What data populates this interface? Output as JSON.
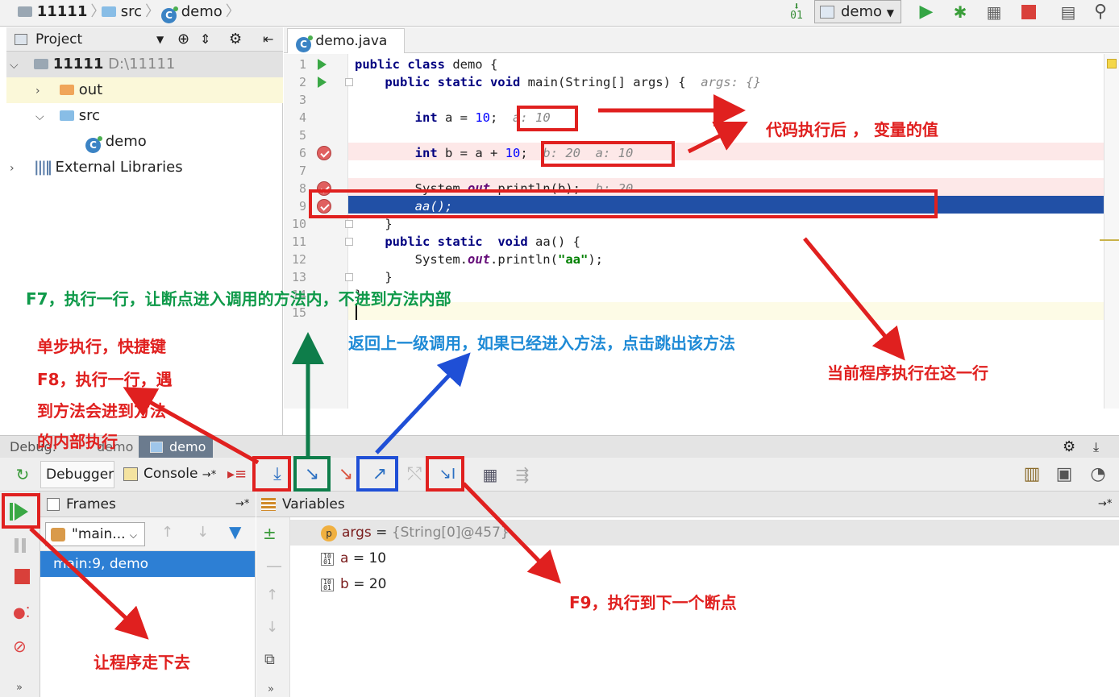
{
  "breadcrumb": {
    "project": "11111",
    "folder": "src",
    "file": "demo"
  },
  "toolbar": {
    "run_config": "demo"
  },
  "project_panel": {
    "title": "Project",
    "tree": [
      {
        "label": "11111",
        "path": "D:\\11111"
      },
      {
        "label": "out"
      },
      {
        "label": "src"
      },
      {
        "label": "demo"
      },
      {
        "label": "External Libraries"
      }
    ]
  },
  "editor": {
    "tab_label": "demo.java",
    "lines": {
      "l1": {
        "kw": "public class",
        "rest": " demo {"
      },
      "l2": {
        "kw": "public static void",
        "rest": " main(String[] args) {  ",
        "hint": "args: {}"
      },
      "l4": {
        "kw": "int",
        "rest": " a = ",
        "num": "10",
        "end": ";  ",
        "hint": "a: 10"
      },
      "l6": {
        "kw": "int",
        "rest": " b = a + ",
        "num": "10",
        "end": ";  ",
        "hint": "b: 20  a: 10"
      },
      "l8": {
        "pre": "System.",
        "fld": "out",
        "post": ".println(b);  ",
        "hint": "b: 20"
      },
      "l9": {
        "code": "aa();"
      },
      "l10": {
        "code": "}"
      },
      "l11": {
        "kw": "public static",
        "mid": "  ",
        "kw2": "void",
        "rest": " aa() {"
      },
      "l12": {
        "pre": "System.",
        "fld": "out",
        "post": ".println(",
        "str": "\"aa\"",
        "end": ");"
      },
      "l13": {
        "code": "}"
      },
      "l14": {
        "code": "}"
      }
    },
    "line_numbers": [
      "1",
      "2",
      "3",
      "4",
      "5",
      "6",
      "7",
      "8",
      "9",
      "10",
      "11",
      "12",
      "13",
      "14",
      "15"
    ]
  },
  "debug": {
    "label": "Debug:",
    "tabs": [
      "demo",
      "demo"
    ],
    "subtabs": {
      "debugger": "Debugger",
      "console": "Console"
    },
    "frames_title": "Frames",
    "thread": "\"main...",
    "frame": "main:9, demo",
    "variables_title": "Variables",
    "variables": [
      {
        "name": "args",
        "value": "{String[0]@457}"
      },
      {
        "name": "a",
        "value": "10"
      },
      {
        "name": "b",
        "value": "20"
      }
    ]
  },
  "annotations": {
    "var_values": "代码执行后 ， 变量的值",
    "f7": "F7，执行一行，让断点进入调用的方法内，不进到方法内部",
    "step_return": "返回上一级调用，如果已经进入方法，点击跳出该方法",
    "current_line": "当前程序执行在这一行",
    "f8_l1": "单步执行，快捷键",
    "f8_l2": "F8，执行一行，遇",
    "f8_l3": "到方法会进到方法",
    "f8_l4": "的内部执行",
    "f9": "F9，执行到下一个断点",
    "resume": "让程序走下去"
  },
  "colors": {
    "current_line": "#2150a6",
    "breakpoint_line": "#fde8e8",
    "annotation_red": "#e0201f",
    "annotation_green": "#0f9a4a",
    "annotation_blue": "#1e8ad6"
  }
}
